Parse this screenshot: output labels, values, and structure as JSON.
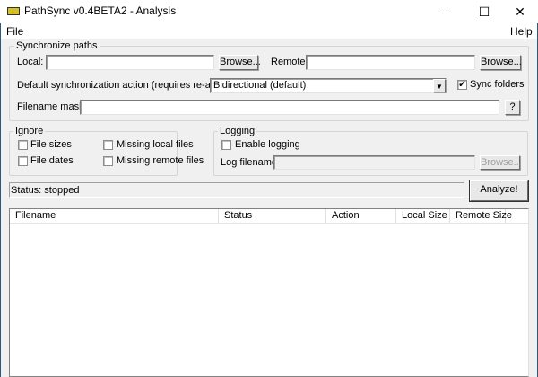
{
  "window": {
    "title": "PathSync v0.4BETA2 - Analysis",
    "minimize": "—",
    "maximize": "☐",
    "close": "✕"
  },
  "menu": {
    "file": "File",
    "help": "Help"
  },
  "sync_paths": {
    "group_label": "Synchronize paths",
    "local_label": "Local:",
    "local_value": "",
    "browse_local": "Browse...",
    "remote_label": "Remote:",
    "remote_value": "",
    "browse_remote": "Browse...",
    "action_label": "Default synchronization action (requires re-analyze):",
    "action_value": "Bidirectional (default)",
    "sync_folders_label": "Sync folders",
    "sync_folders_checked": true,
    "mask_label": "Filename mask:",
    "mask_value": "",
    "help_button": "?"
  },
  "ignore": {
    "group_label": "Ignore",
    "file_sizes": "File sizes",
    "file_dates": "File dates",
    "missing_local": "Missing local files",
    "missing_remote": "Missing remote files"
  },
  "logging": {
    "group_label": "Logging",
    "enable_logging": "Enable logging",
    "log_filename_label": "Log filename:",
    "log_filename_value": "",
    "browse": "Browse..."
  },
  "status": {
    "text": "Status: stopped",
    "analyze_button": "Analyze!"
  },
  "list": {
    "columns": [
      "Filename",
      "Status",
      "Action",
      "Local Size",
      "Remote Size"
    ],
    "rows": []
  }
}
